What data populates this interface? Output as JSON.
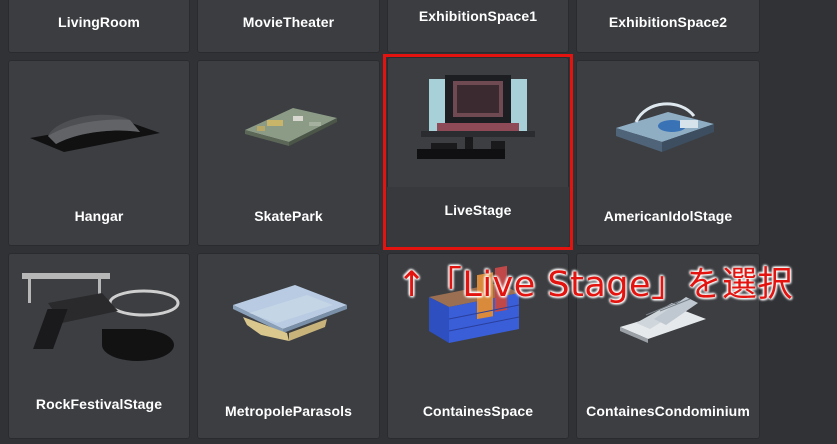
{
  "grid": {
    "row1": [
      "LivingRoom",
      "MovieTheater",
      "ExhibitionSpace1",
      "ExhibitionSpace2"
    ],
    "row2": [
      "Hangar",
      "SkatePark",
      "LiveStage",
      "AmericanIdolStage"
    ],
    "row3": [
      "RockFestivalStage",
      "MetropoleParasols",
      "ContainesSpace",
      "ContainesCondominium"
    ]
  },
  "selected_item": "LiveStage",
  "annotation_text": "↑「Live Stage」を選択",
  "colors": {
    "background": "#303236",
    "tile": "#3c3e42",
    "highlight": "#e3140f",
    "label": "#ffffff"
  }
}
